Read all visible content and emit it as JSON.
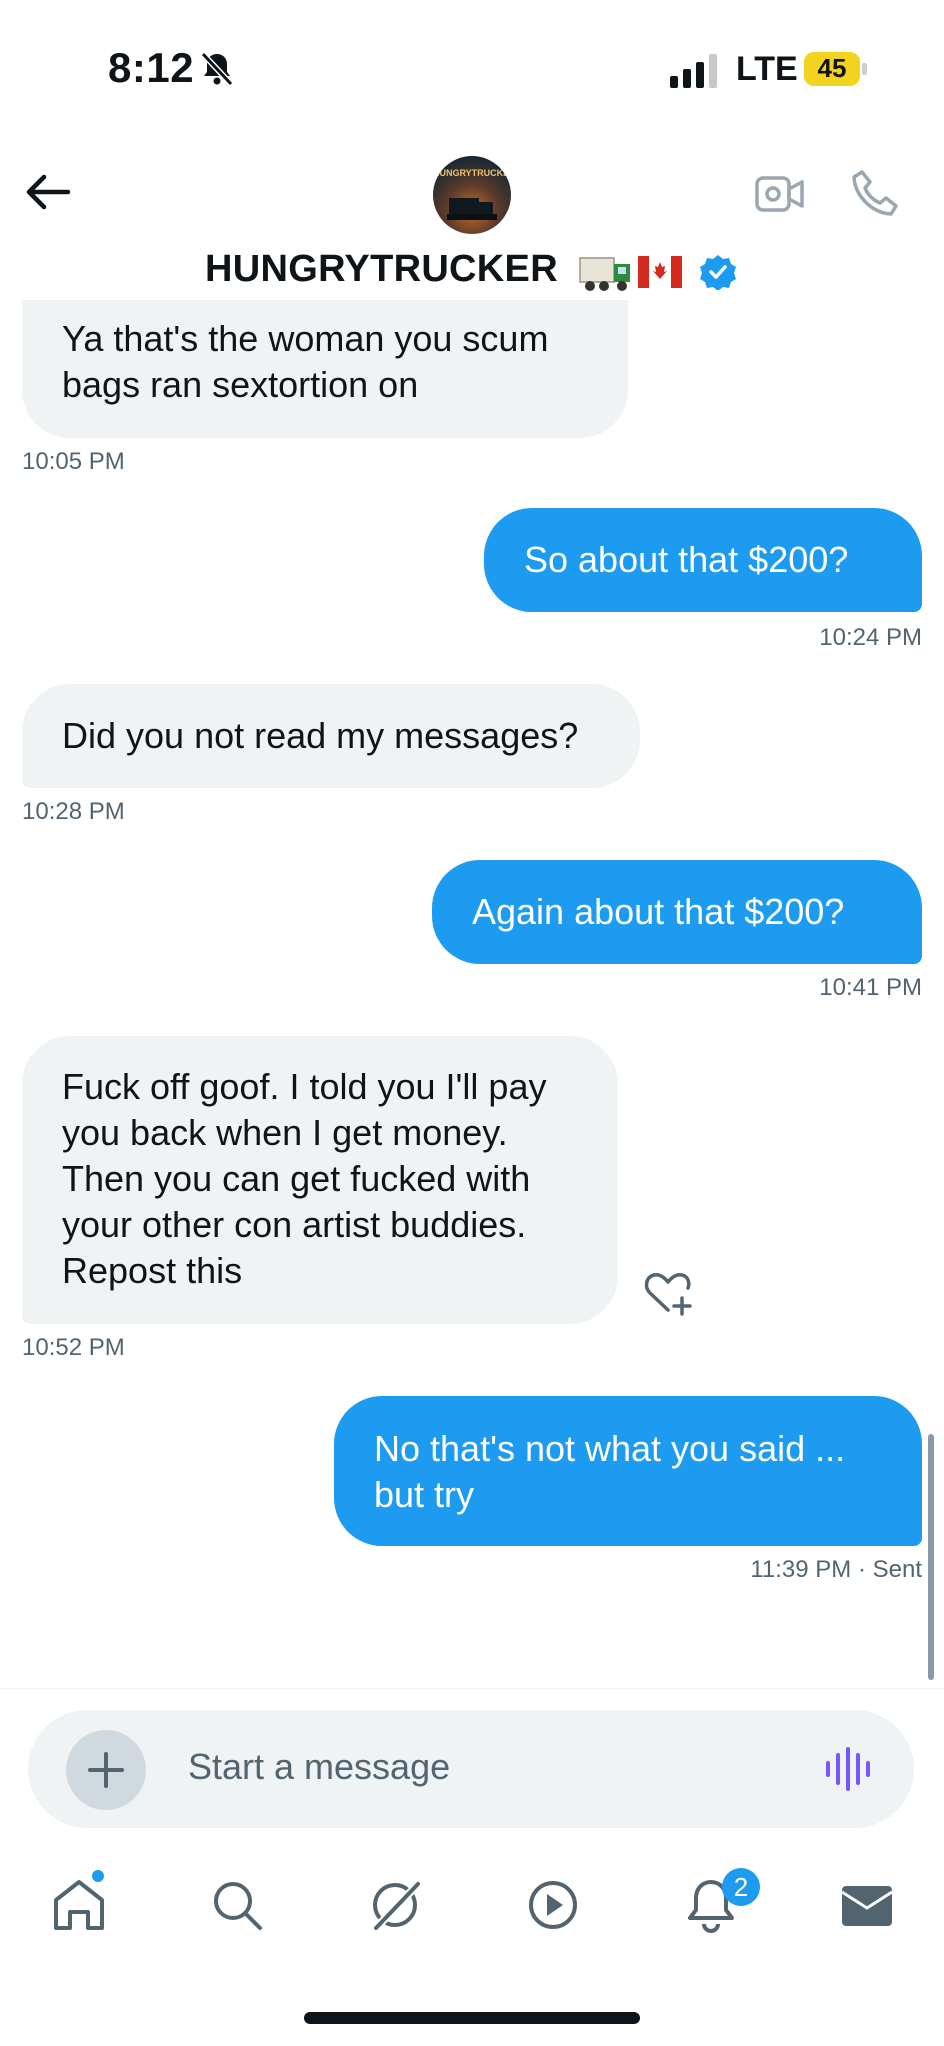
{
  "status_bar": {
    "time": "8:12",
    "network": "LTE",
    "battery": "45"
  },
  "header": {
    "display_name": "HUNGRYTRUCKER",
    "avatar_text": "HUNGRYTRUCKER"
  },
  "messages": [
    {
      "direction": "incoming",
      "text": "Ya that's the woman you scum\nbags ran sextortion on",
      "time": "10:05 PM"
    },
    {
      "direction": "outgoing",
      "text": "So about that $200?",
      "time": "10:24 PM"
    },
    {
      "direction": "incoming",
      "text": "Did you not read my messages?",
      "time": "10:28 PM"
    },
    {
      "direction": "outgoing",
      "text": "Again about that $200?",
      "time": "10:41 PM"
    },
    {
      "direction": "incoming",
      "text": "Fuck off goof. I told you I'll pay\nyou back when I get money.\nThen you can get fucked with\nyour other con artist buddies.\nRepost this",
      "time": "10:52 PM"
    },
    {
      "direction": "outgoing",
      "text": "No that's not what you said ...\nbut try",
      "time": "11:39 PM",
      "status": "· Sent"
    }
  ],
  "composer": {
    "placeholder": "Start a message"
  },
  "nav": {
    "items": [
      "home-icon",
      "search-icon",
      "grok-icon",
      "video-icon",
      "notifications-icon",
      "messages-icon"
    ],
    "notifications_badge": "2"
  },
  "colors": {
    "accent": "#1d9bf0",
    "incoming_bubble": "#eff3f4",
    "muted_text": "#536471",
    "battery": "#f4d31e"
  }
}
